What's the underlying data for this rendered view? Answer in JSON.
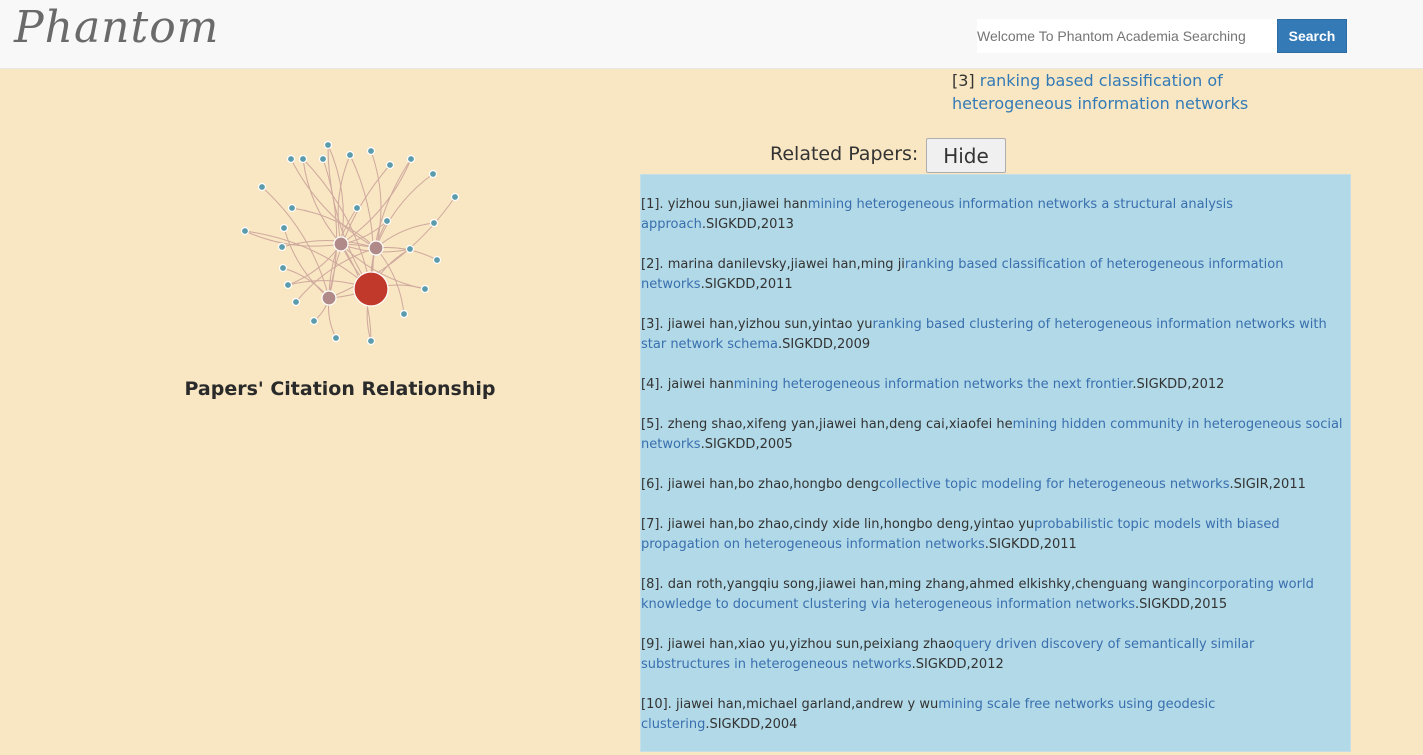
{
  "brand": "Phantom",
  "search": {
    "placeholder": "Welcome To Phantom Academia Searching",
    "value": "",
    "button": "Search"
  },
  "selected": {
    "index": "[3]",
    "title": "ranking based classification of heterogeneous information networks"
  },
  "graph": {
    "title": "Papers' Citation Relationship",
    "colors": {
      "main": "#c0392b",
      "hub": "#b08a88",
      "leaf": "#5b9bab",
      "edge": "#cfa89e"
    }
  },
  "related": {
    "label": "Related Papers:",
    "hide_button": "Hide"
  },
  "papers": [
    {
      "num": "[1].",
      "authors": "yizhou sun,jiawei han",
      "title": "mining heterogeneous information networks a structural analysis approach",
      "venue": "SIGKDD",
      "year": "2013"
    },
    {
      "num": "[2].",
      "authors": "marina danilevsky,jiawei han,ming ji",
      "title": "ranking based classification of heterogeneous information networks",
      "venue": "SIGKDD",
      "year": "2011"
    },
    {
      "num": "[3].",
      "authors": "jiawei han,yizhou sun,yintao yu",
      "title": "ranking based clustering of heterogeneous information networks with star network schema",
      "venue": "SIGKDD",
      "year": "2009"
    },
    {
      "num": "[4].",
      "authors": "jaiwei han",
      "title": "mining heterogeneous information networks the next frontier",
      "venue": "SIGKDD",
      "year": "2012"
    },
    {
      "num": "[5].",
      "authors": "zheng shao,xifeng yan,jiawei han,deng cai,xiaofei he",
      "title": "mining hidden community in heterogeneous social networks",
      "venue": "SIGKDD",
      "year": "2005"
    },
    {
      "num": "[6].",
      "authors": "jiawei han,bo zhao,hongbo deng",
      "title": "collective topic modeling for heterogeneous networks",
      "venue": "SIGIR",
      "year": "2011"
    },
    {
      "num": "[7].",
      "authors": "jiawei han,bo zhao,cindy xide lin,hongbo deng,yintao yu",
      "title": "probabilistic topic models with biased propagation on heterogeneous information networks",
      "venue": "SIGKDD",
      "year": "2011"
    },
    {
      "num": "[8].",
      "authors": "dan roth,yangqiu song,jiawei han,ming zhang,ahmed elkishky,chenguang wang",
      "title": "incorporating world knowledge to document clustering via heterogeneous information networks",
      "venue": "SIGKDD",
      "year": "2015"
    },
    {
      "num": "[9].",
      "authors": "jiawei han,xiao yu,yizhou sun,peixiang zhao",
      "title": "query driven discovery of semantically similar substructures in heterogeneous networks",
      "venue": "SIGKDD",
      "year": "2012"
    },
    {
      "num": "[10].",
      "authors": "jiawei han,michael garland,andrew y wu",
      "title": "mining scale free networks using geodesic clustering",
      "venue": "SIGKDD",
      "year": "2004"
    }
  ]
}
